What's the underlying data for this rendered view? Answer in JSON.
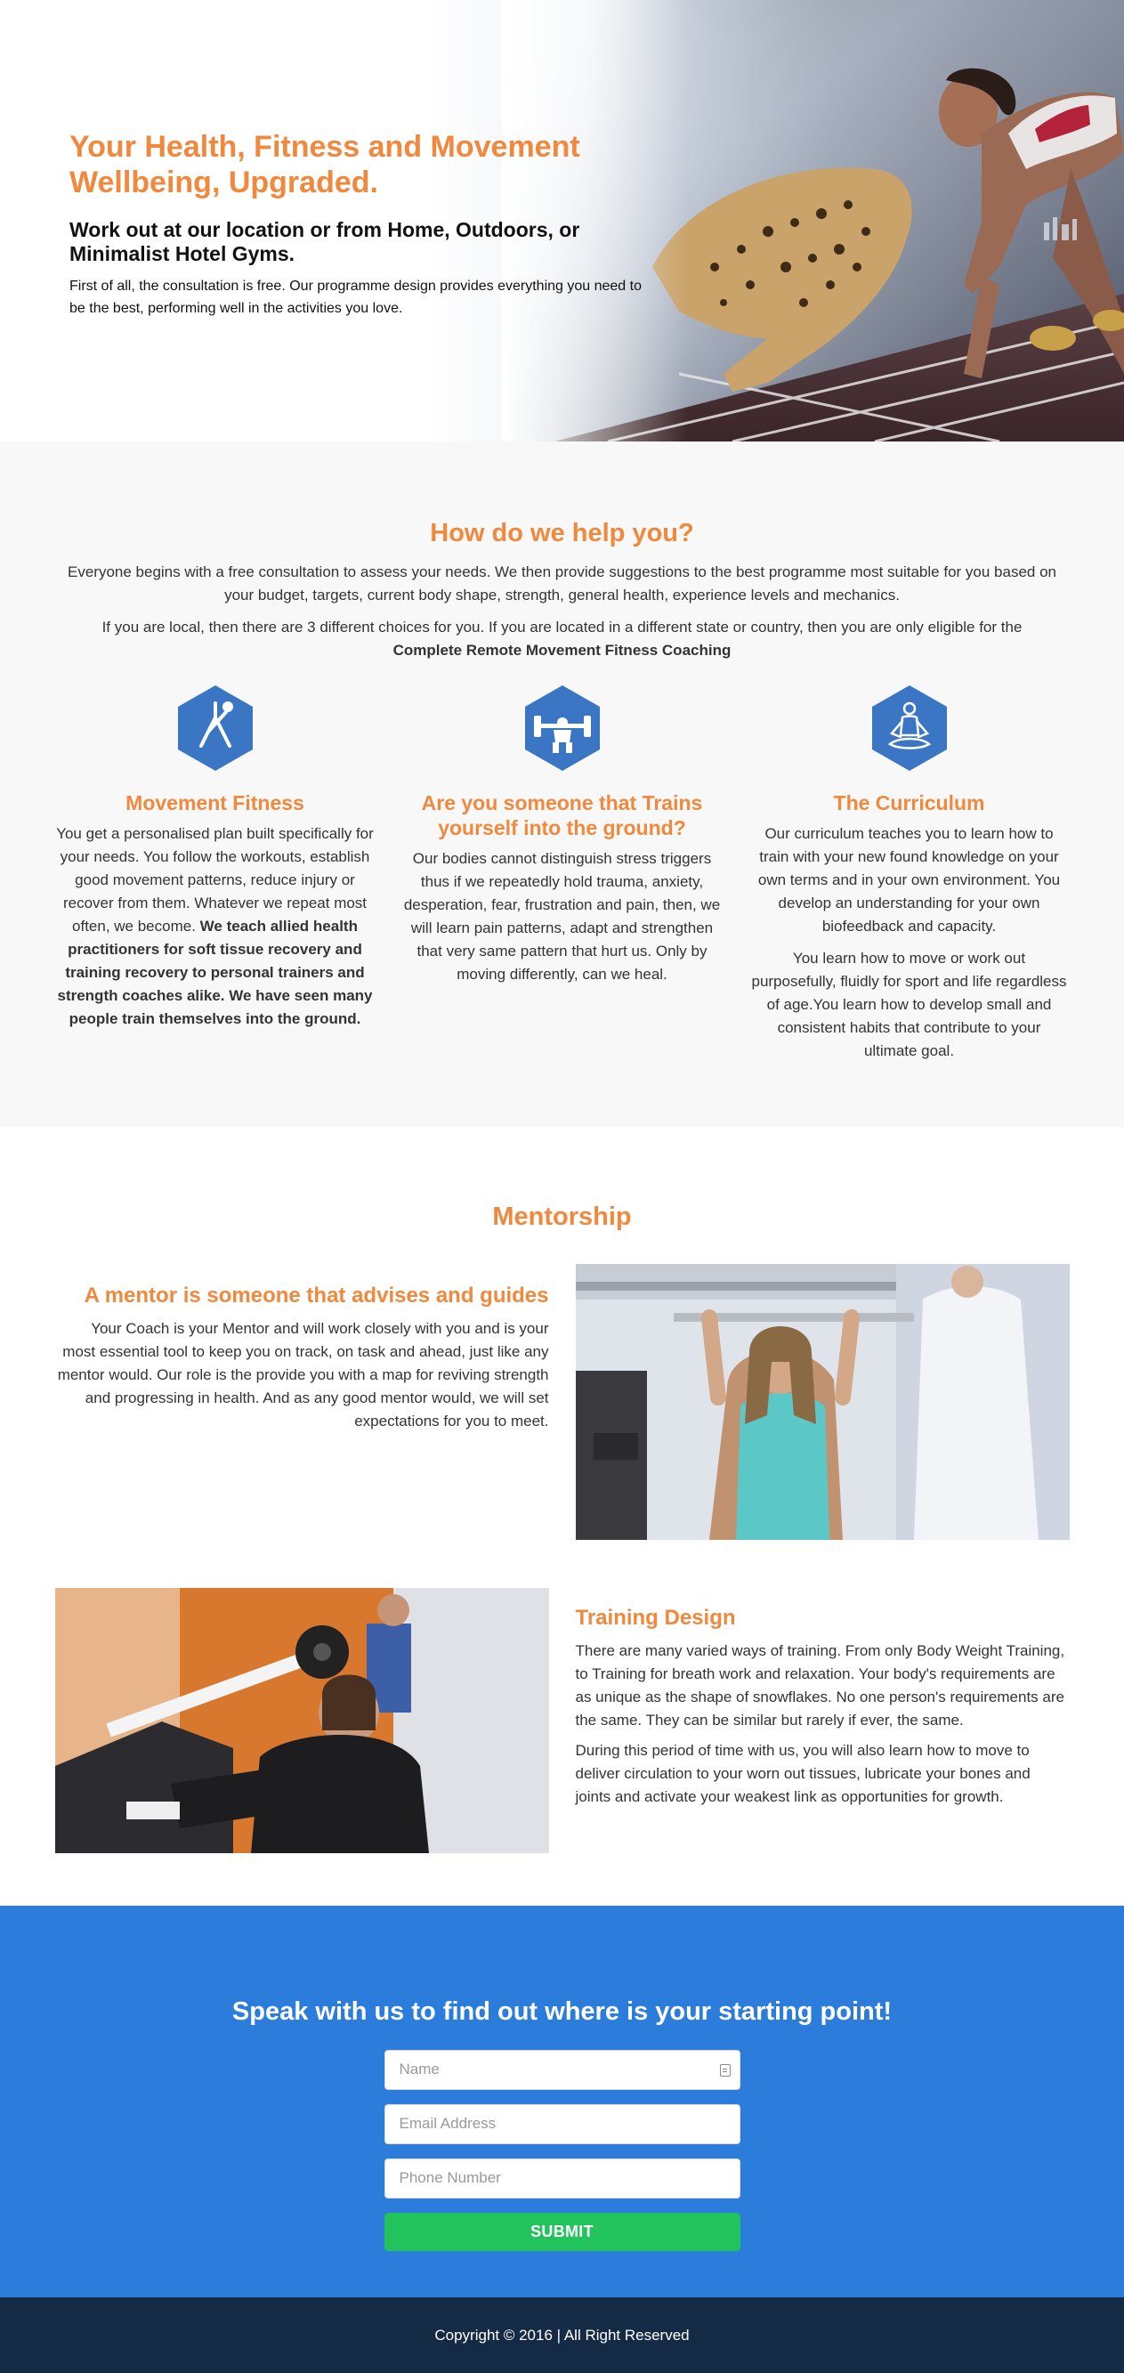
{
  "hero": {
    "title": "Your Health, Fitness and Movement Wellbeing, Upgraded.",
    "subtitle": "Work out at our location or from Home, Outdoors, or Minimalist Hotel Gyms.",
    "description": "First of all, the consultation is free. Our programme design provides everything you need to be the best, performing well in the activities you love."
  },
  "help": {
    "title": "How do we help you?",
    "intro": "Everyone begins with a free consultation to assess your needs. We then provide suggestions to the best programme most suitable for you based on your budget, targets, current body shape, strength, general health, experience levels and mechanics.",
    "local_note": "If you are local, then there are 3 different choices for you. If you are located in a different state or country, then you are only eligible for the",
    "local_note_bold": "Complete Remote Movement Fitness Coaching",
    "columns": [
      {
        "icon": "yoga-pose-icon",
        "title": "Movement Fitness",
        "text": "You get a personalised plan built specifically for your needs. You follow the workouts, establish good movement patterns, reduce injury or recover from them. Whatever we repeat most often, we become.",
        "text_bold": "We teach allied health practitioners for soft tissue recovery and training recovery to personal trainers and strength coaches alike. We have seen many people train themselves into the ground."
      },
      {
        "icon": "weightlifter-icon",
        "title": "Are you someone that Trains yourself into the ground?",
        "text": "Our bodies cannot distinguish stress triggers thus if we repeatedly hold trauma, anxiety, desperation, fear, frustration and pain, then, we will learn pain patterns, adapt and strengthen that very same pattern that hurt us. Only by moving differently, can we heal."
      },
      {
        "icon": "meditation-icon",
        "title": "The Curriculum",
        "text": "Our curriculum teaches you to learn how to train with your new found knowledge on your own terms and in your own environment. You develop an understanding for your own biofeedback and capacity.",
        "text2": "You learn how to move or work out purposefully, fluidly for sport and life regardless of age.You learn how to develop small and consistent habits that contribute to your ultimate goal."
      }
    ],
    "icon_color": "#3a76c4"
  },
  "mentorship": {
    "title": "Mentorship",
    "mentor_block": {
      "title": "A mentor is someone that advises and guides",
      "text": "Your Coach is your Mentor and will work closely with you and is your most essential tool to keep you on track, on task and ahead, just like any mentor would. Our role is the provide you with a map for reviving strength and progressing in health. And as any good mentor would, we will set expectations for you to meet."
    },
    "training_block": {
      "title": "Training Design",
      "text": "There are many varied ways of training. From only Body Weight Training, to Training for breath work and relaxation. Your body's requirements are as unique as the shape of snowflakes. No one person's requirements are the same. They can be similar but rarely if ever, the same.",
      "text2": "During this period of time with us, you will also learn how to move to deliver circulation to your worn out tissues, lubricate your bones and joints and activate your weakest link as opportunities for growth."
    }
  },
  "cta": {
    "title": "Speak with us to find out where is your starting point!",
    "name_placeholder": "Name",
    "email_placeholder": "Email Address",
    "phone_placeholder": "Phone Number",
    "submit_label": "SUBMIT",
    "background": "#2c7ddb",
    "button_color": "#22c25d"
  },
  "footer": {
    "copyright": "Copyright © 2016 | All Right Reserved"
  },
  "colors": {
    "accent": "#f0893d",
    "footer_bg": "#152a44"
  }
}
